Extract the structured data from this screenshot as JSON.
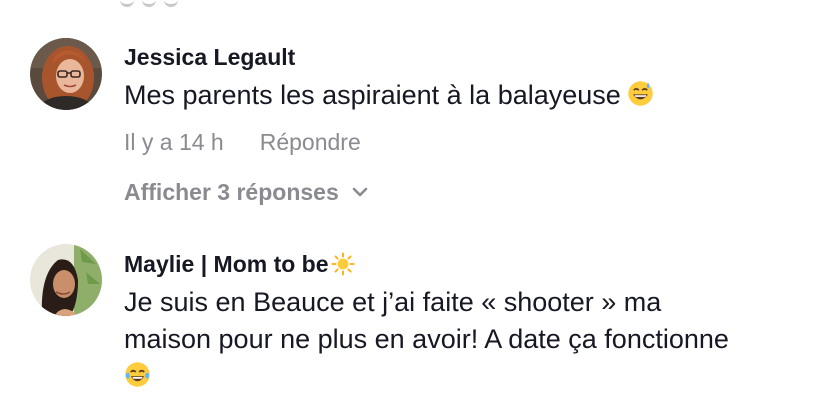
{
  "comments": [
    {
      "username": "Jessica Legault",
      "text": "Mes parents les aspiraient à la balayeuse",
      "emoji": "grinning-sweat-emoji",
      "time": "Il y a 14 h",
      "reply_label": "Répondre",
      "view_replies_label": "Afficher 3 réponses"
    },
    {
      "username": "Maylie | Mom to be",
      "username_emoji": "sun-emoji",
      "text_lines": [
        "Je suis en Beauce et j’ai faite « shooter » ma",
        "maison pour ne plus en avoir! A date ça fonctionne"
      ],
      "emoji": "tears-of-joy-emoji"
    }
  ],
  "colors": {
    "text_primary": "#161823",
    "text_secondary": "#8a8b91",
    "background": "#ffffff"
  }
}
